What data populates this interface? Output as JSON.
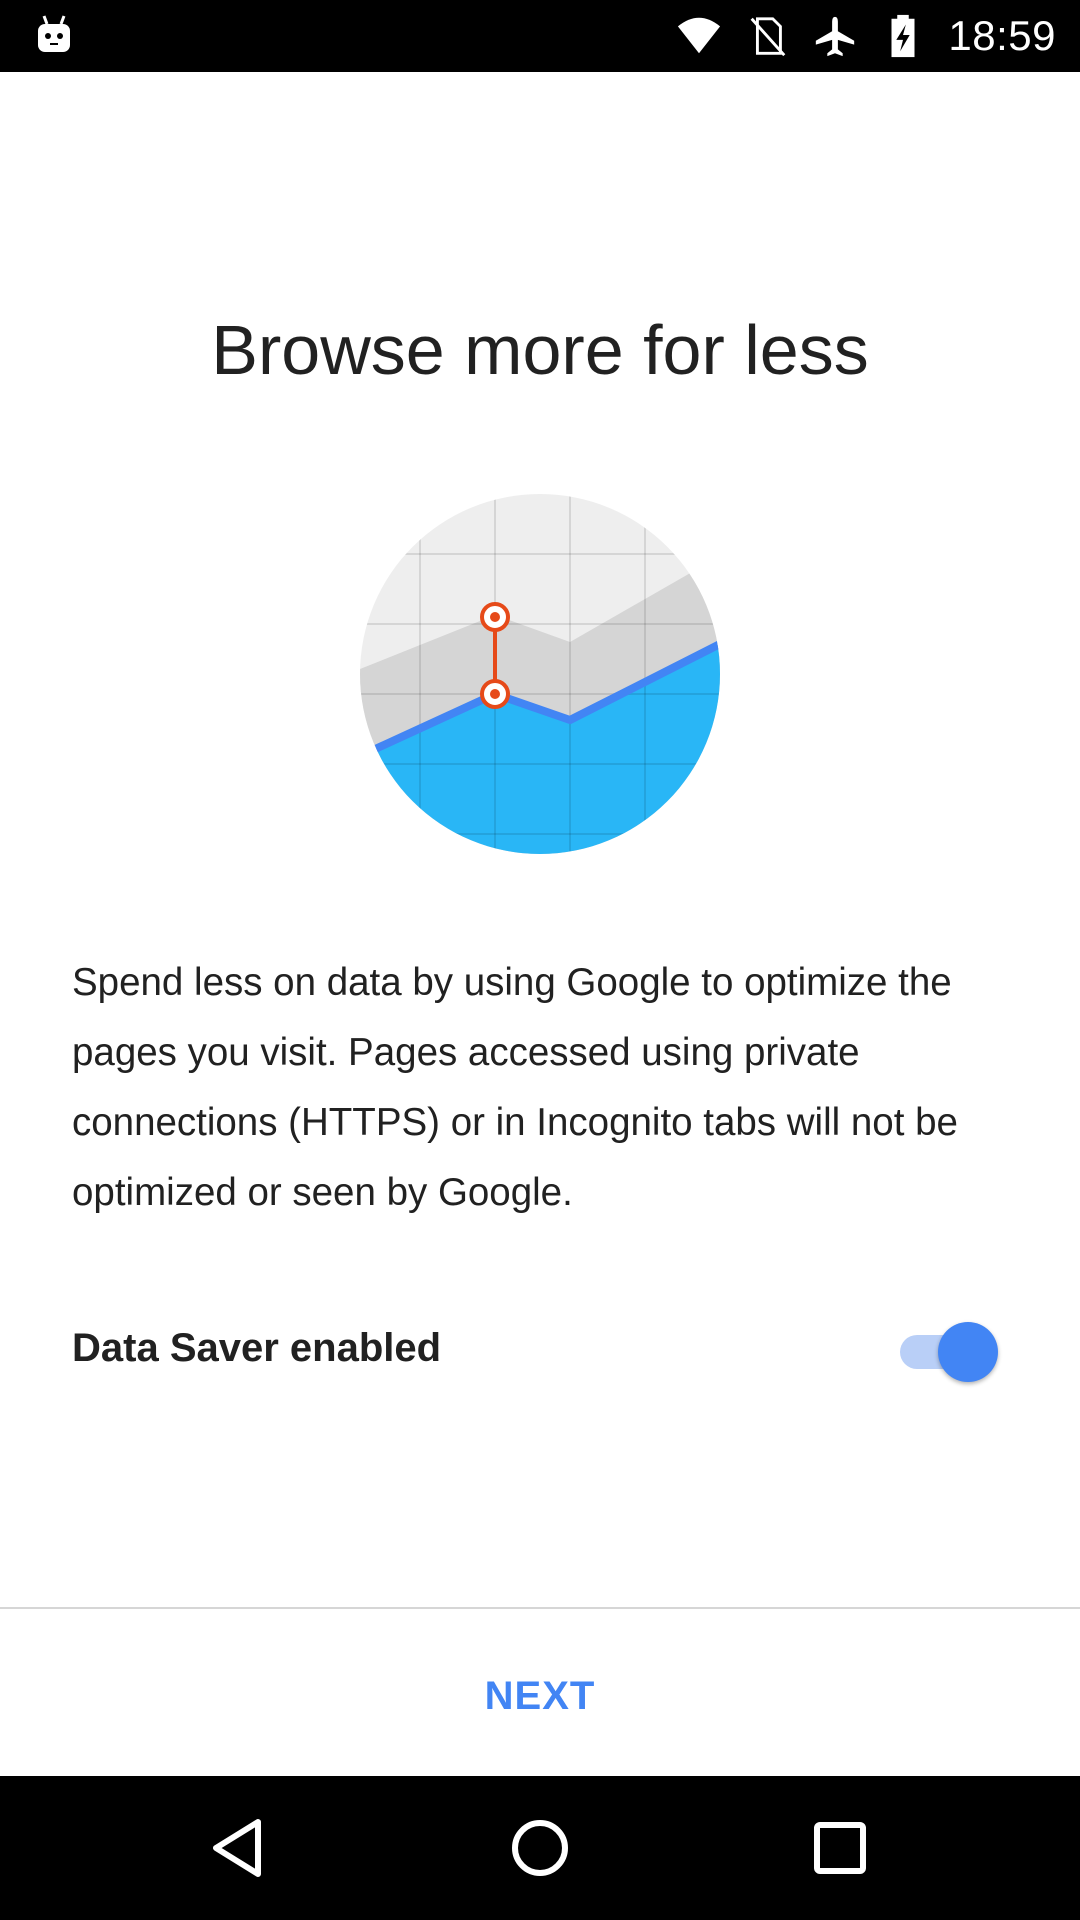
{
  "status_bar": {
    "time": "18:59",
    "icons": [
      "android-debug-icon",
      "wifi-icon",
      "no-sim-icon",
      "airplane-mode-icon",
      "battery-charging-icon"
    ]
  },
  "title": "Browse more for less",
  "illustration": {
    "icon": "data-saver-chart-illustration",
    "colors": {
      "circle_bg": "#eeeeee",
      "gray_area": "#d5d5d5",
      "blue_area": "#29b6f6",
      "line": "#4285f4",
      "marker": "#e64a19"
    }
  },
  "description": "Spend less on data by using Google to optimize the pages you visit. Pages accessed using private connections (HTTPS) or in Incognito tabs will not be optimized or seen by Google.",
  "toggle": {
    "label": "Data Saver enabled",
    "checked": true
  },
  "button": {
    "label": "NEXT"
  },
  "navigation": {
    "icons": [
      "back-icon",
      "home-icon",
      "recents-icon"
    ]
  },
  "colors": {
    "accent": "#4285f4",
    "text": "#212121",
    "status_bar": "#000000",
    "nav_bar": "#000000"
  }
}
